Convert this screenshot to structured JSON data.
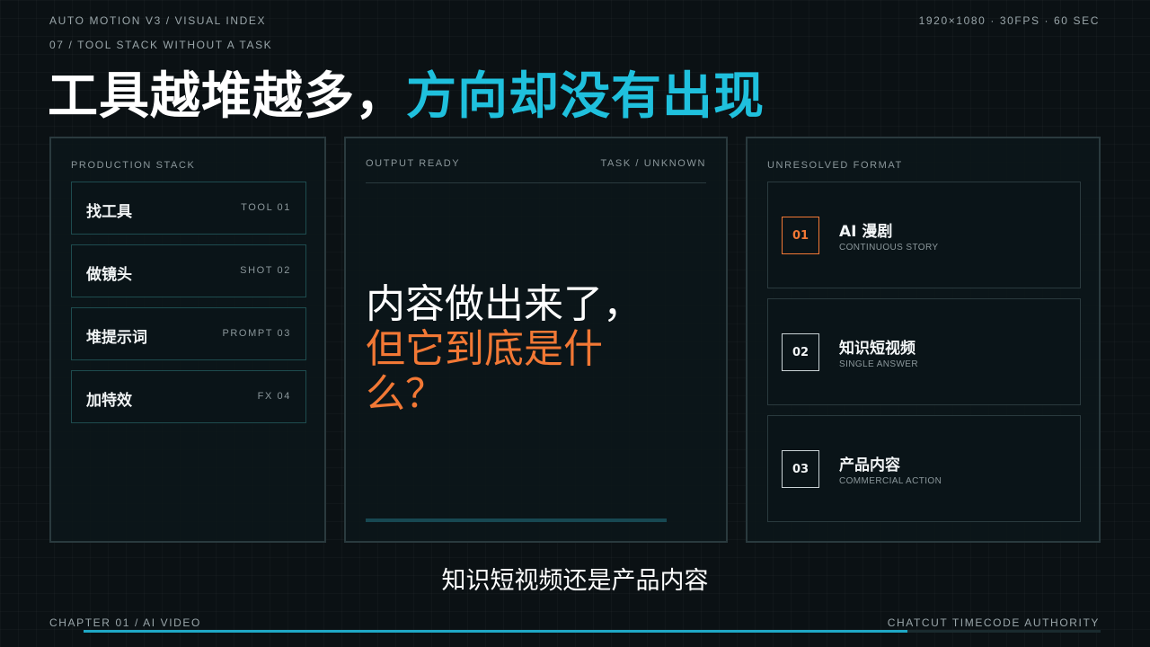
{
  "header": {
    "brand": "AUTO MOTION V3 / VISUAL INDEX",
    "spec": "1920×1080 · 30FPS · 60 SEC",
    "section": "07 / TOOL STACK WITHOUT A TASK",
    "headline_white": "工具越堆越多，",
    "headline_accent": "方向却没有出现"
  },
  "left_panel": {
    "label": "PRODUCTION STACK",
    "items": [
      {
        "label": "找工具",
        "tag": "TOOL 01"
      },
      {
        "label": "做镜头",
        "tag": "SHOT 02"
      },
      {
        "label": "堆提示词",
        "tag": "PROMPT 03"
      },
      {
        "label": "加特效",
        "tag": "FX 04"
      }
    ]
  },
  "mid_panel": {
    "label_left": "OUTPUT READY",
    "label_right": "TASK / UNKNOWN",
    "line1": "内容做出来了，",
    "line2": "但它到底是什么？"
  },
  "right_panel": {
    "label": "UNRESOLVED FORMAT",
    "cards": [
      {
        "num": "01",
        "title": "AI 漫剧",
        "sub": "CONTINUOUS STORY",
        "active": true
      },
      {
        "num": "02",
        "title": "知识短视频",
        "sub": "SINGLE ANSWER",
        "active": false
      },
      {
        "num": "03",
        "title": "产品内容",
        "sub": "COMMERCIAL ACTION",
        "active": false
      }
    ]
  },
  "subtitle": "知识短视频还是产品内容",
  "footer": {
    "chapter": "CHAPTER 01 / AI VIDEO",
    "authority": "CHATCUT TIMECODE AUTHORITY",
    "progress": 0.81
  },
  "colors": {
    "accent_cyan": "#1fc0dd",
    "accent_orange": "#f27835",
    "background": "#0b1114"
  }
}
